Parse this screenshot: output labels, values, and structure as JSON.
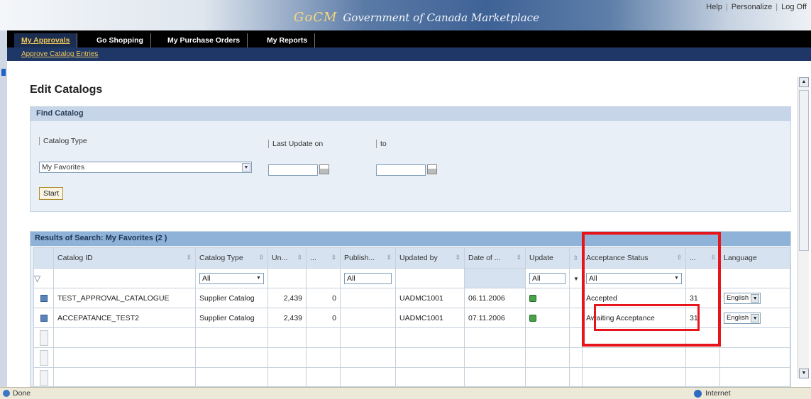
{
  "header": {
    "logo": "GoCM",
    "brand": "Government of Canada Marketplace",
    "links": [
      "Help",
      "Personalize",
      "Log Off"
    ]
  },
  "nav": {
    "tabs": [
      "My Approvals",
      "Go Shopping",
      "My Purchase Orders",
      "My Reports"
    ],
    "active": "My Approvals",
    "subnav": "Approve Catalog Entries"
  },
  "page": {
    "title": "Edit Catalogs"
  },
  "find": {
    "header": "Find Catalog",
    "catalog_type_label": "Catalog Type",
    "catalog_type_value": "My Favorites",
    "last_update_label": "Last Update on",
    "to_label": "to",
    "last_update_value": "",
    "to_value": "",
    "start_label": "Start"
  },
  "results": {
    "header": "Results of Search: My Favorites (2 )",
    "columns": [
      "Catalog ID",
      "Catalog Type",
      "Un...",
      "...",
      "Publish...",
      "Updated by",
      "Date of ...",
      "Update",
      "Acceptance Status",
      "...",
      "Language"
    ],
    "filters": {
      "catalog_type": "All",
      "publish": "All",
      "update": "All",
      "acceptance": "All"
    },
    "rows": [
      {
        "catalog_id": "TEST_APPROVAL_CATALOGUE",
        "catalog_type": "Supplier Catalog",
        "un": "2,439",
        "col4": "0",
        "publish": "",
        "updated_by": "UADMC1001",
        "date": "06.11.2006",
        "acceptance": "Accepted",
        "col10": "31",
        "language": "English"
      },
      {
        "catalog_id": "ACCEPATANCE_TEST2",
        "catalog_type": "Supplier Catalog",
        "un": "2,439",
        "col4": "0",
        "publish": "",
        "updated_by": "UADMC1001",
        "date": "07.11.2006",
        "acceptance": "Awaiting Acceptance",
        "col10": "31",
        "language": "English"
      }
    ]
  },
  "status": {
    "left": "Done",
    "zone": "Internet"
  }
}
